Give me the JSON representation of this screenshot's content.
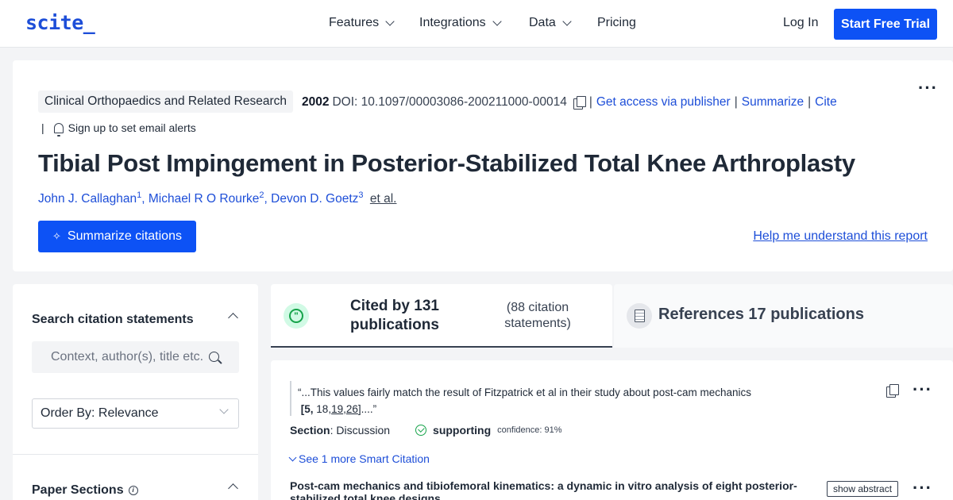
{
  "nav": {
    "logo": "scite_",
    "links": [
      "Features",
      "Integrations",
      "Data",
      "Pricing"
    ],
    "login": "Log In",
    "trial": "Start Free Trial"
  },
  "paper": {
    "journal": "Clinical Orthopaedics and Related Research",
    "year": "2002",
    "doi": "DOI: 10.1097/00003086-200211000-00014",
    "access": "Get access via publisher",
    "summarize": "Summarize",
    "cite": "Cite",
    "alerts": "Sign up to set email alerts",
    "title": "Tibial Post Impingement in Posterior-Stabilized Total Knee Arthroplasty",
    "authors": [
      {
        "name": "John J. Callaghan",
        "sup": "1"
      },
      {
        "name": "Michael R O Rourke",
        "sup": "2"
      },
      {
        "name": "Devon D. Goetz",
        "sup": "3"
      }
    ],
    "etal": "et al.",
    "summarize_btn": "Summarize citations",
    "help": "Help me understand this report"
  },
  "sidebar": {
    "search_heading": "Search citation statements",
    "search_placeholder": "Context, author(s), title etc.",
    "order": "Order By: Relevance",
    "sections_heading": "Paper Sections"
  },
  "tabs": {
    "cited": "Cited by 131 publications",
    "statements": "(88 citation statements)",
    "references": "References 17 publications"
  },
  "citation": {
    "quote": "“...This values fairly match the result of Fitzpatrick et al in their study about post-cam mechanics",
    "refs_bold": "[5,",
    "refs_a": "18,",
    "refs_b": "19",
    "refs_c": ",",
    "refs_d": "26",
    "refs_end": "]....”",
    "section_label": "Section",
    "section_value": ": Discussion",
    "support": "supporting",
    "confidence": "confidence: 91%",
    "more": "See 1 more Smart Citation",
    "paper_title": "Post-cam mechanics and tibiofemoral kinematics: a dynamic in vitro analysis of eight posterior-stabilized total knee designs",
    "show_abstract": "show abstract"
  },
  "colors": {
    "accent": "#0d52f5",
    "link": "#1d4ed8",
    "supporting": "#16a34a"
  }
}
